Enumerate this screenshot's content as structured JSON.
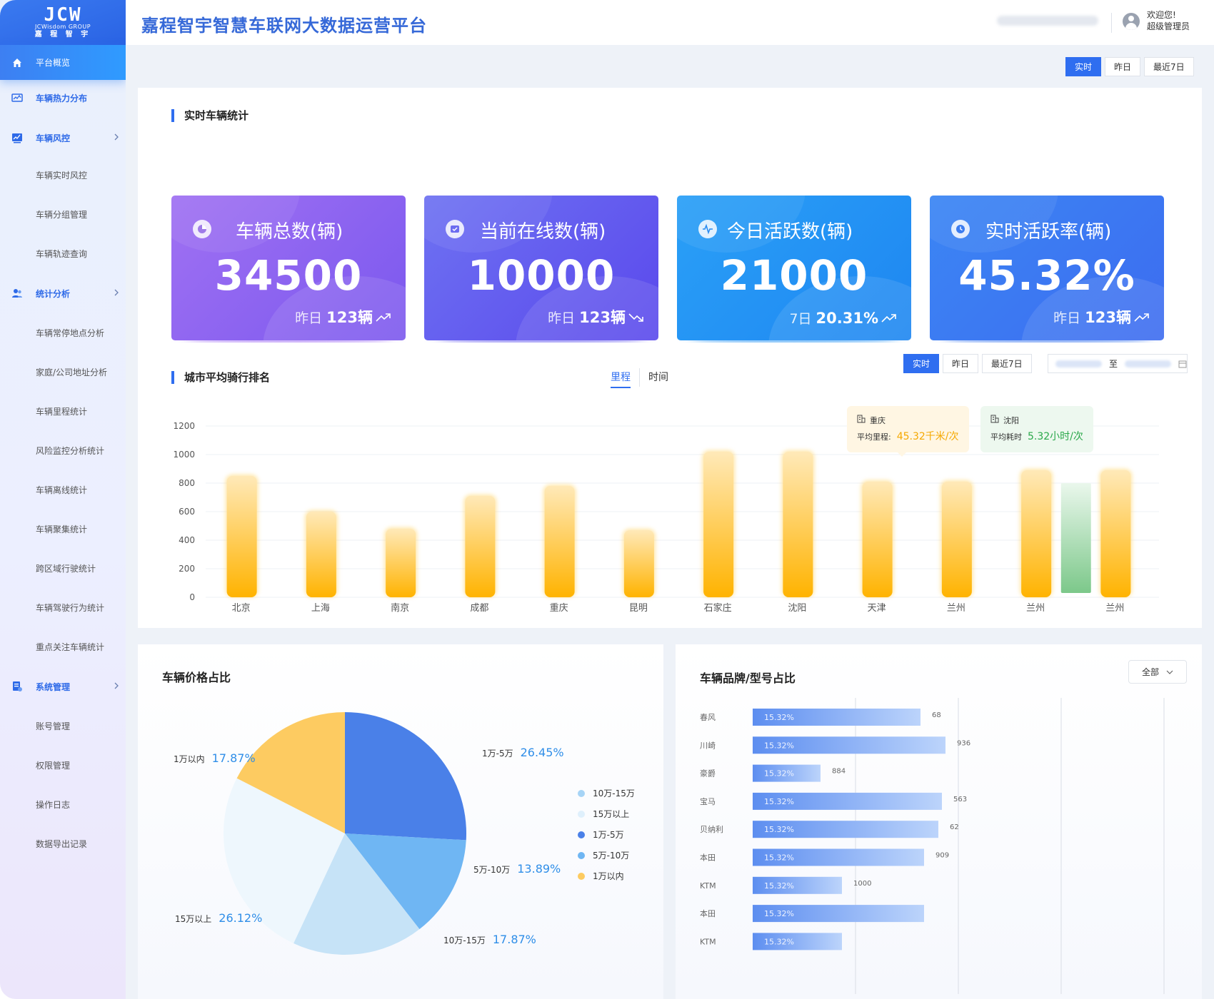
{
  "logo": {
    "mark": "JCW",
    "en": "JCWisdom GROUP",
    "cn": "嘉 程 智 宇"
  },
  "header": {
    "title": "嘉程智宇智慧车联网大数据运营平台",
    "welcome": "欢迎您!",
    "role": "超级管理员"
  },
  "sidebar": {
    "items": [
      {
        "label": "平台概览",
        "icon": "home-icon",
        "level": "top",
        "active": true
      },
      {
        "label": "车辆热力分布",
        "icon": "heatmap-icon",
        "level": "top"
      },
      {
        "label": "车辆风控",
        "icon": "line-chart-icon",
        "level": "top",
        "chevron": true
      },
      {
        "label": "车辆实时风控",
        "level": "sub"
      },
      {
        "label": "车辆分组管理",
        "level": "sub"
      },
      {
        "label": "车辆轨迹查询",
        "level": "sub"
      },
      {
        "label": "统计分析",
        "icon": "users-icon",
        "level": "top",
        "chevron": true
      },
      {
        "label": "车辆常停地点分析",
        "level": "sub"
      },
      {
        "label": "家庭/公司地址分析",
        "level": "sub"
      },
      {
        "label": "车辆里程统计",
        "level": "sub"
      },
      {
        "label": "风险监控分析统计",
        "level": "sub"
      },
      {
        "label": "车辆离线统计",
        "level": "sub"
      },
      {
        "label": "车辆聚集统计",
        "level": "sub"
      },
      {
        "label": "跨区域行驶统计",
        "level": "sub"
      },
      {
        "label": "车辆驾驶行为统计",
        "level": "sub"
      },
      {
        "label": "重点关注车辆统计",
        "level": "sub"
      },
      {
        "label": "系统管理",
        "icon": "settings-doc-icon",
        "level": "top",
        "chevron": true
      },
      {
        "label": "账号管理",
        "level": "sub"
      },
      {
        "label": "权限管理",
        "level": "sub"
      },
      {
        "label": "操作日志",
        "level": "sub"
      },
      {
        "label": "数据导出记录",
        "level": "sub"
      }
    ]
  },
  "topRange": {
    "options": [
      "实时",
      "昨日",
      "最近7日"
    ],
    "selected": "实时"
  },
  "stats": {
    "title": "实时车辆统计",
    "cards": [
      {
        "label": "车辆总数(辆)",
        "value": "34500",
        "foot_label": "昨日",
        "foot_value": "123辆",
        "trend": "up",
        "icon": "pie-icon"
      },
      {
        "label": "当前在线数(辆)",
        "value": "10000",
        "foot_label": "昨日",
        "foot_value": "123辆",
        "trend": "down",
        "icon": "check-icon"
      },
      {
        "label": "今日活跃数(辆)",
        "value": "21000",
        "foot_label": "7日",
        "foot_value": "20.31%",
        "trend": "up",
        "icon": "pulse-icon"
      },
      {
        "label": "实时活跃率(辆)",
        "value": "45.32%",
        "foot_label": "昨日",
        "foot_value": "123辆",
        "trend": "up",
        "icon": "clock-icon"
      }
    ]
  },
  "cityRanking": {
    "title": "城市平均骑行排名",
    "tabs": [
      "里程",
      "时间"
    ],
    "activeTab": "里程",
    "range": {
      "options": [
        "实时",
        "昨日",
        "最近7日"
      ],
      "selected": "实时"
    },
    "dateSeparator": "至",
    "tooltips": [
      {
        "city": "重庆",
        "label": "平均里程:",
        "value": "45.32千米/次",
        "color": "#f5a800"
      },
      {
        "city": "沈阳",
        "label": "平均耗时",
        "value": "5.32小时/次",
        "color": "#2aa84a"
      }
    ]
  },
  "priceShare": {
    "title": "车辆价格占比",
    "legend": [
      "10万-15万",
      "15万以上",
      "1万-5万",
      "5万-10万",
      "1万以内"
    ],
    "slices": [
      {
        "label": "1万-5万",
        "pct": "26.45%"
      },
      {
        "label": "5万-10万",
        "pct": "13.89%"
      },
      {
        "label": "10万-15万",
        "pct": "17.87%"
      },
      {
        "label": "15万以上",
        "pct": "26.12%"
      },
      {
        "label": "1万以内",
        "pct": "17.87%"
      }
    ]
  },
  "brandShare": {
    "title": "车辆品牌/型号占比",
    "filter": "全部"
  },
  "colors": {
    "accent": "#2f6ef0",
    "bar": "#ffb300",
    "barHighlight": "#7cc88a"
  },
  "chart_data": [
    {
      "type": "bar",
      "title": "城市平均骑行排名",
      "categories": [
        "北京",
        "上海",
        "南京",
        "成都",
        "重庆",
        "昆明",
        "石家庄",
        "沈阳",
        "天津",
        "兰州",
        "兰州",
        "兰州"
      ],
      "values": [
        850,
        600,
        480,
        710,
        780,
        470,
        1020,
        1020,
        810,
        810,
        890,
        890
      ],
      "highlight": {
        "index": 10,
        "value": 800,
        "color": "#7cc88a"
      },
      "yticks": [
        0,
        200,
        400,
        600,
        800,
        1000,
        1200
      ],
      "ylim": [
        0,
        1200
      ],
      "grid": true
    },
    {
      "type": "pie",
      "title": "车辆价格占比",
      "categories": [
        "1万-5万",
        "5万-10万",
        "10万-15万",
        "15万以上",
        "1万以内"
      ],
      "values": [
        26.45,
        13.89,
        17.87,
        26.12,
        17.87
      ],
      "colors": [
        "#4a80e8",
        "#6fb6f3",
        "#c6e3f7",
        "#eef7fd",
        "#fdcb61"
      ],
      "legend": "right"
    },
    {
      "type": "bar",
      "title": "车辆品牌/型号占比",
      "orientation": "horizontal",
      "categories": [
        "春风",
        "川崎",
        "豪爵",
        "宝马",
        "贝纳利",
        "本田",
        "KTM",
        "本田",
        "KTM"
      ],
      "values": [
        68,
        936,
        884,
        563,
        62,
        909,
        1000,
        null,
        null
      ],
      "bar_label": "15.32%",
      "bar_fill": [
        0.47,
        0.54,
        0.19,
        0.53,
        0.52,
        0.48,
        0.25,
        0.48,
        0.25
      ]
    }
  ]
}
